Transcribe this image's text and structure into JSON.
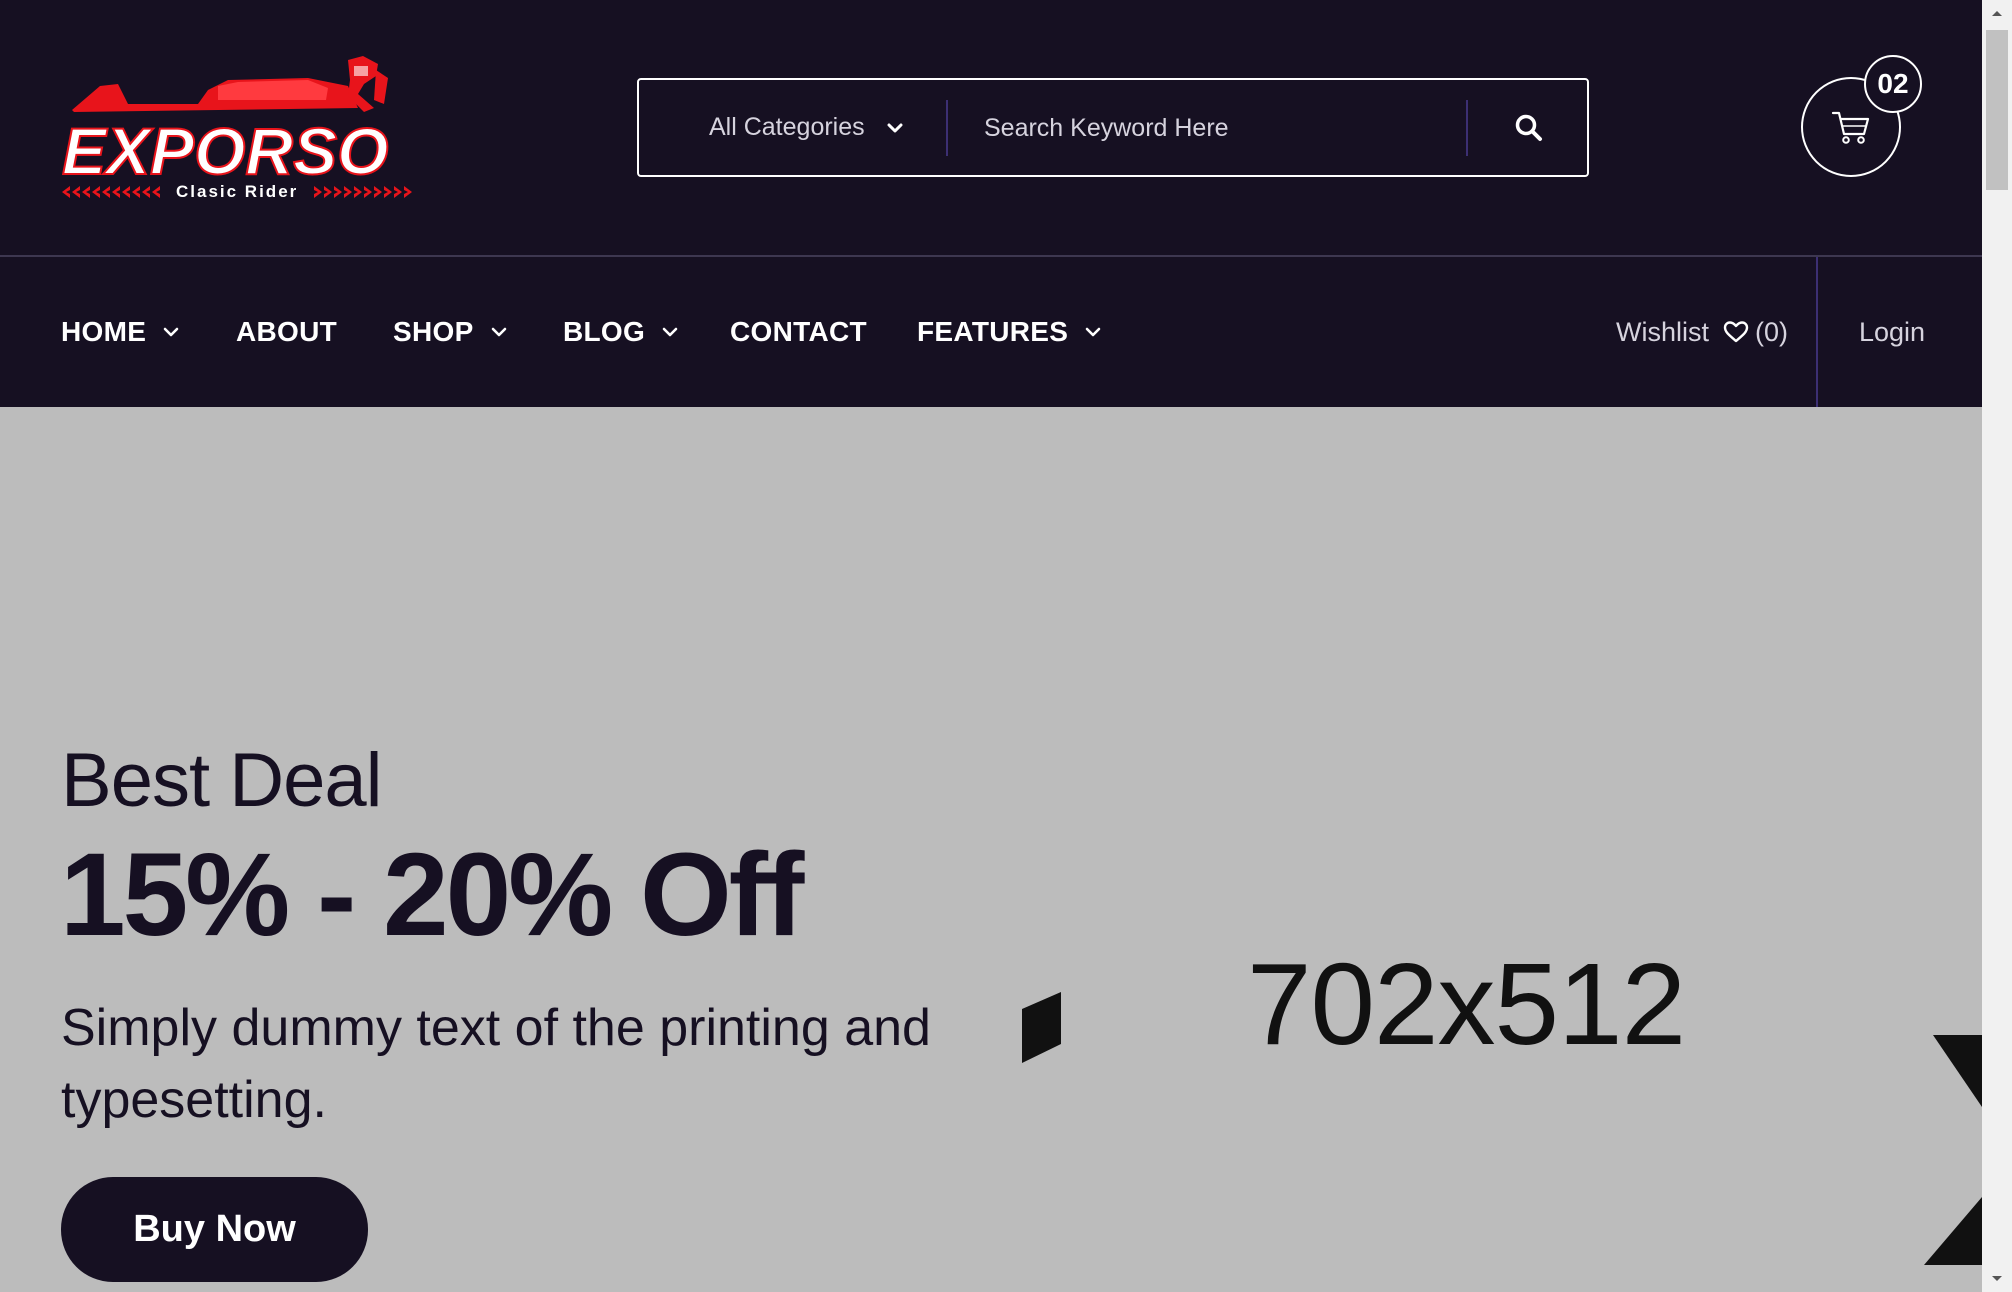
{
  "brand": {
    "name": "EXPORSO",
    "tagline": "Clasic Rider"
  },
  "search": {
    "category_label": "All Categories",
    "placeholder": "Search Keyword Here"
  },
  "cart": {
    "count": "02"
  },
  "nav": {
    "items": [
      {
        "label": "HOME",
        "has_dropdown": true
      },
      {
        "label": "ABOUT",
        "has_dropdown": false
      },
      {
        "label": "SHOP",
        "has_dropdown": true
      },
      {
        "label": "BLOG",
        "has_dropdown": true
      },
      {
        "label": "CONTACT",
        "has_dropdown": false
      },
      {
        "label": "FEATURES",
        "has_dropdown": true
      }
    ],
    "wishlist_label": "Wishlist",
    "wishlist_count": "(0)",
    "login_label": "Login"
  },
  "hero": {
    "eyebrow": "Best Deal",
    "headline": "15% - 20% Off",
    "subtext": "Simply dummy text of the printing and typesetting.",
    "cta_label": "Buy Now",
    "image_placeholder": "702x512"
  },
  "colors": {
    "header_bg": "#161022",
    "hero_bg": "#bcbcbc",
    "brand_red": "#e8141b",
    "divider_purple": "#3c2f73"
  }
}
